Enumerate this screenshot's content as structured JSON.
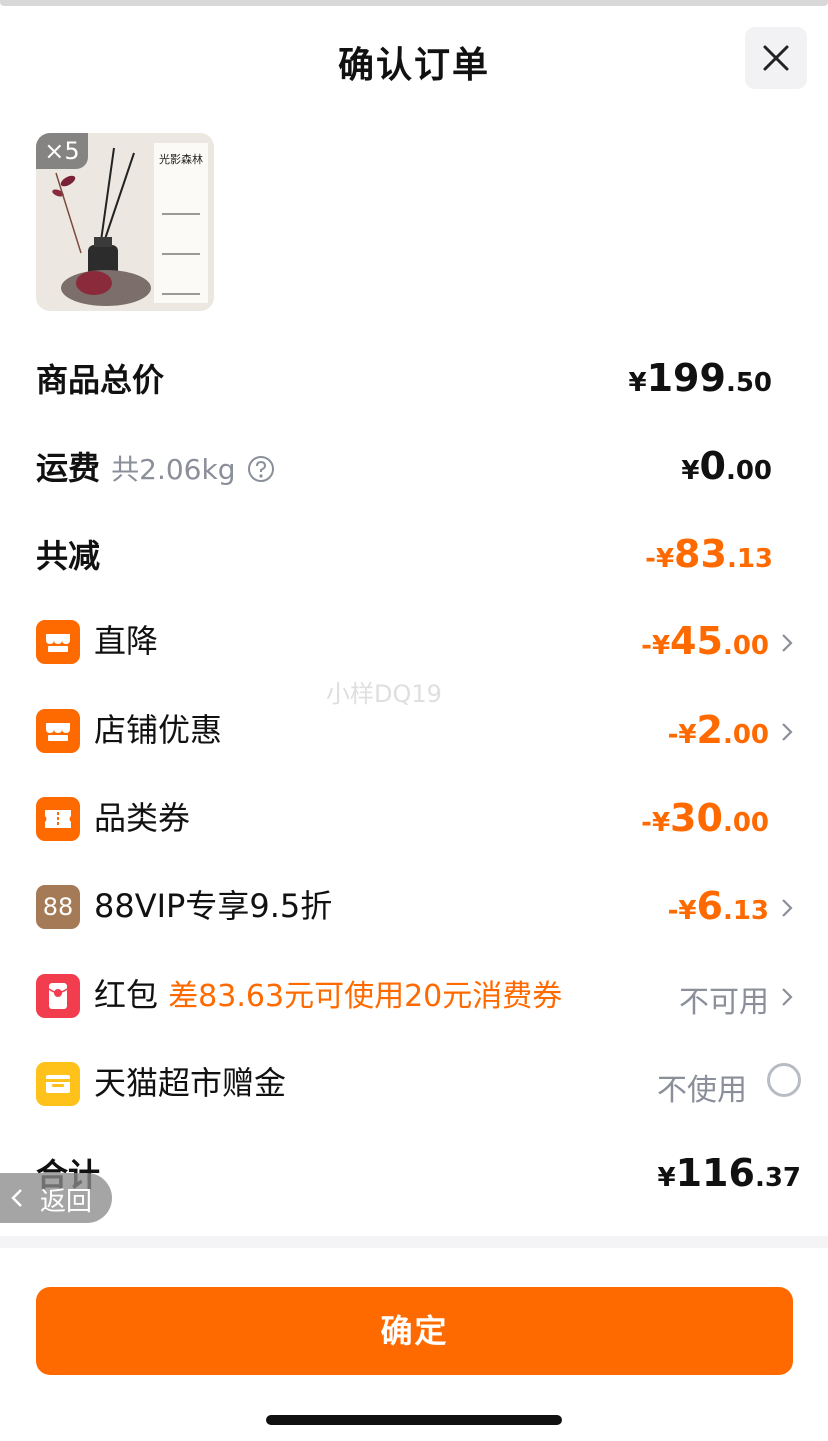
{
  "header": {
    "title": "确认订单",
    "close_icon": "close-icon"
  },
  "product": {
    "quantity_badge": "×5",
    "image_title": "光影森林"
  },
  "rows": {
    "subtotal": {
      "label": "商品总价",
      "cur": "¥",
      "int": "199",
      "dec": ".50"
    },
    "shipping": {
      "label": "运费",
      "weight": "共2.06kg",
      "help_icon": "question-circle-icon",
      "cur": "¥",
      "int": "0",
      "dec": ".00"
    },
    "total_discount": {
      "label": "共减",
      "cur": "-¥",
      "int": "83",
      "dec": ".13"
    },
    "direct": {
      "label": "直降",
      "icon": "store-icon",
      "cur": "-¥",
      "int": "45",
      "dec": ".00"
    },
    "shop": {
      "label": "店铺优惠",
      "icon": "store-icon",
      "cur": "-¥",
      "int": "2",
      "dec": ".00"
    },
    "category": {
      "label": "品类券",
      "icon": "ticket-icon",
      "cur": "-¥",
      "int": "30",
      "dec": ".00"
    },
    "vip": {
      "label": "88VIP专享9.5折",
      "icon_text": "88",
      "cur": "-¥",
      "int": "6",
      "dec": ".13"
    },
    "redpacket": {
      "label": "红包",
      "note": "差83.63元可使用20元消费券",
      "status": "不可用",
      "icon": "red-packet-icon"
    },
    "tmall": {
      "label": "天猫超市赠金",
      "status": "不使用",
      "icon": "wallet-icon"
    },
    "sum": {
      "label": "合计",
      "cur": "¥",
      "int": "116",
      "dec": ".37"
    }
  },
  "watermark": "小样DQ19",
  "back": {
    "label": "返回"
  },
  "footer": {
    "confirm_label": "确定"
  },
  "colors": {
    "accent": "#ff6a00",
    "muted": "#8a8f99",
    "red": "#f23d4f",
    "yellow": "#ffc21a",
    "vip": "#a57a56"
  }
}
